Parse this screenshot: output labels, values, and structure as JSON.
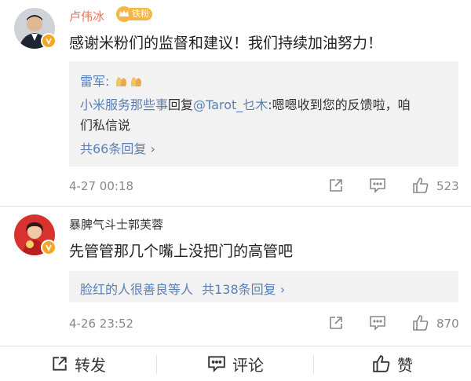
{
  "comments": [
    {
      "username": "卢伟冰",
      "fan_badge": "铁粉",
      "text": "感谢米粉们的监督和建议！我们持续加油努力！",
      "reply_preview": {
        "author": "雷军:",
        "line1_author": "小米服务那些事",
        "line1_reply_word": "回复",
        "line1_mention": "@Tarot_乜木",
        "line1_text": ":嗯嗯收到您的反馈啦，咱",
        "line2_text": "们私信说",
        "more": "共66条回复 ›"
      },
      "time": "4-27 00:18",
      "likes": "523"
    },
    {
      "username": "暴脾气斗士郭芙蓉",
      "text": "先管管那几个嘴上没把门的高管吧",
      "reply_preview": {
        "people": "脸红的人很善良等人",
        "more": "共138条回复 ›"
      },
      "time": "4-26 23:52",
      "likes": "870"
    }
  ],
  "footer": {
    "repost": "转发",
    "comment": "评论",
    "like": "赞"
  },
  "colors": {
    "username_orange": "#eb7350",
    "link_blue": "#5a7fb5",
    "reply_bg": "#f2f2f2",
    "badge_orange": "#f6b646"
  },
  "icons": [
    "share-icon",
    "comment-icon",
    "like-icon",
    "verified-badge-icon",
    "crown-icon",
    "clap-emoji-icon"
  ]
}
